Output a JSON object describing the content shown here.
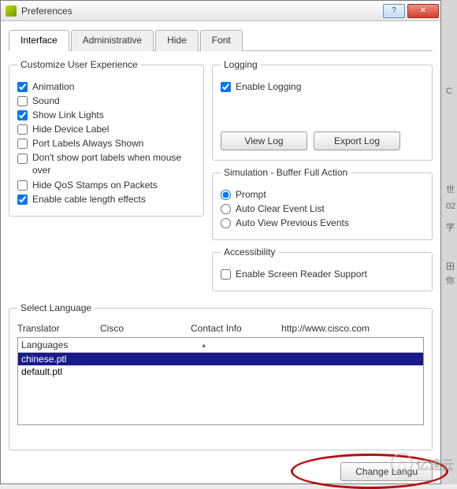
{
  "window": {
    "title": "Preferences"
  },
  "tabs": {
    "interface": "Interface",
    "administrative": "Administrative",
    "hide": "Hide",
    "font": "Font"
  },
  "customize": {
    "legend": "Customize User Experience",
    "animation": {
      "label": "Animation",
      "checked": true
    },
    "sound": {
      "label": "Sound",
      "checked": false
    },
    "show_link_lights": {
      "label": "Show Link Lights",
      "checked": true
    },
    "hide_device_label": {
      "label": "Hide Device Label",
      "checked": false
    },
    "port_labels_always": {
      "label": "Port Labels Always Shown",
      "checked": false
    },
    "dont_show_port_hover": {
      "label": "Don't show port labels when mouse over",
      "checked": false
    },
    "hide_qos": {
      "label": "Hide QoS Stamps on Packets",
      "checked": false
    },
    "cable_length": {
      "label": "Enable cable length effects",
      "checked": true
    }
  },
  "logging": {
    "legend": "Logging",
    "enable": {
      "label": "Enable Logging",
      "checked": true
    },
    "view_log": "View Log",
    "export_log": "Export Log"
  },
  "sim": {
    "legend": "Simulation - Buffer Full Action",
    "prompt": "Prompt",
    "auto_clear": "Auto Clear Event List",
    "auto_view": "Auto View Previous Events",
    "selected": "prompt"
  },
  "accessibility": {
    "legend": "Accessibility",
    "screen_reader": {
      "label": "Enable Screen Reader Support",
      "checked": false
    }
  },
  "language": {
    "legend": "Select Language",
    "headers": {
      "translator": "Translator",
      "cisco": "Cisco",
      "contact": "Contact Info",
      "url": "http://www.cisco.com"
    },
    "col_header": "Languages",
    "items": [
      "chinese.ptl",
      "default.ptl"
    ],
    "selected": "chinese.ptl",
    "change_btn": "Change Langu"
  },
  "watermark": {
    "text": "亿速云"
  }
}
